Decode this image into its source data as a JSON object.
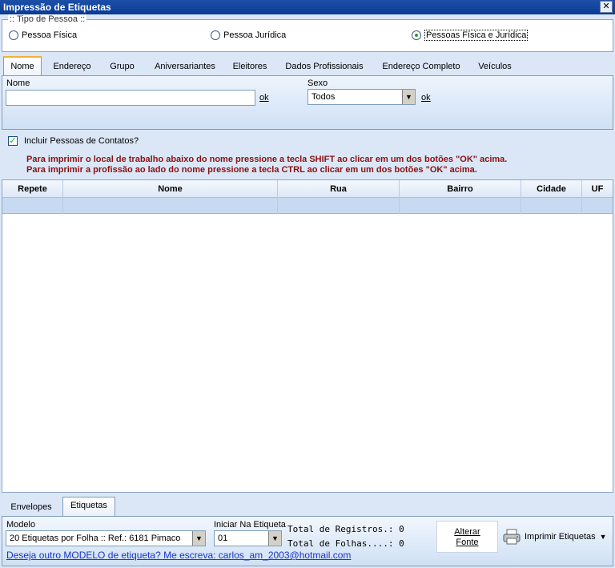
{
  "window": {
    "title": "Impressão de Etiquetas",
    "close_glyph": "✕"
  },
  "tipo_pessoa": {
    "legend": ":: Tipo de Pessoa ::",
    "options": [
      {
        "label": "Pessoa Física",
        "selected": false
      },
      {
        "label": "Pessoa Jurídica",
        "selected": false
      },
      {
        "label": "Pessoas Física e Jurídica",
        "selected": true
      }
    ]
  },
  "tabs": [
    "Nome",
    "Endereço",
    "Grupo",
    "Aniversariantes",
    "Eleitores",
    "Dados Profissionais",
    "Endereço Completo",
    "Veículos"
  ],
  "nome_panel": {
    "nome_label": "Nome",
    "nome_value": "",
    "ok1": "ok",
    "sexo_label": "Sexo",
    "sexo_value": "Todos",
    "ok2": "ok"
  },
  "include_contacts": {
    "label": "Incluir Pessoas de Contatos?",
    "checked": true
  },
  "notes": [
    "Para imprimir o local de trabalho abaixo do nome pressione a tecla SHIFT ao clicar em um dos botões \"OK\" acima.",
    "Para imprimir a profissão ao lado do nome pressione a tecla CTRL ao clicar em um dos botões \"OK\" acima."
  ],
  "grid": {
    "columns": [
      "Repete",
      "Nome",
      "Rua",
      "Bairro",
      "Cidade",
      "UF"
    ]
  },
  "bottom_tabs": [
    "Envelopes",
    "Etiquetas"
  ],
  "bottom": {
    "modelo_label": "Modelo",
    "modelo_value": "20 Etiquetas por Folha :: Ref.: 6181  Pimaco",
    "iniciar_label": "Iniciar Na Etiqueta",
    "iniciar_value": "01",
    "total_registros": "Total de Registros.: 0",
    "total_folhas": "Total de Folhas....: 0",
    "alterar_fonte_1": "Alterar",
    "alterar_fonte_2": "Fonte",
    "imprimir": "Imprimir Etiquetas",
    "footer_link": "Deseja outro MODELO de etiqueta? Me escreva: carlos_am_2003@hotmail.com"
  }
}
